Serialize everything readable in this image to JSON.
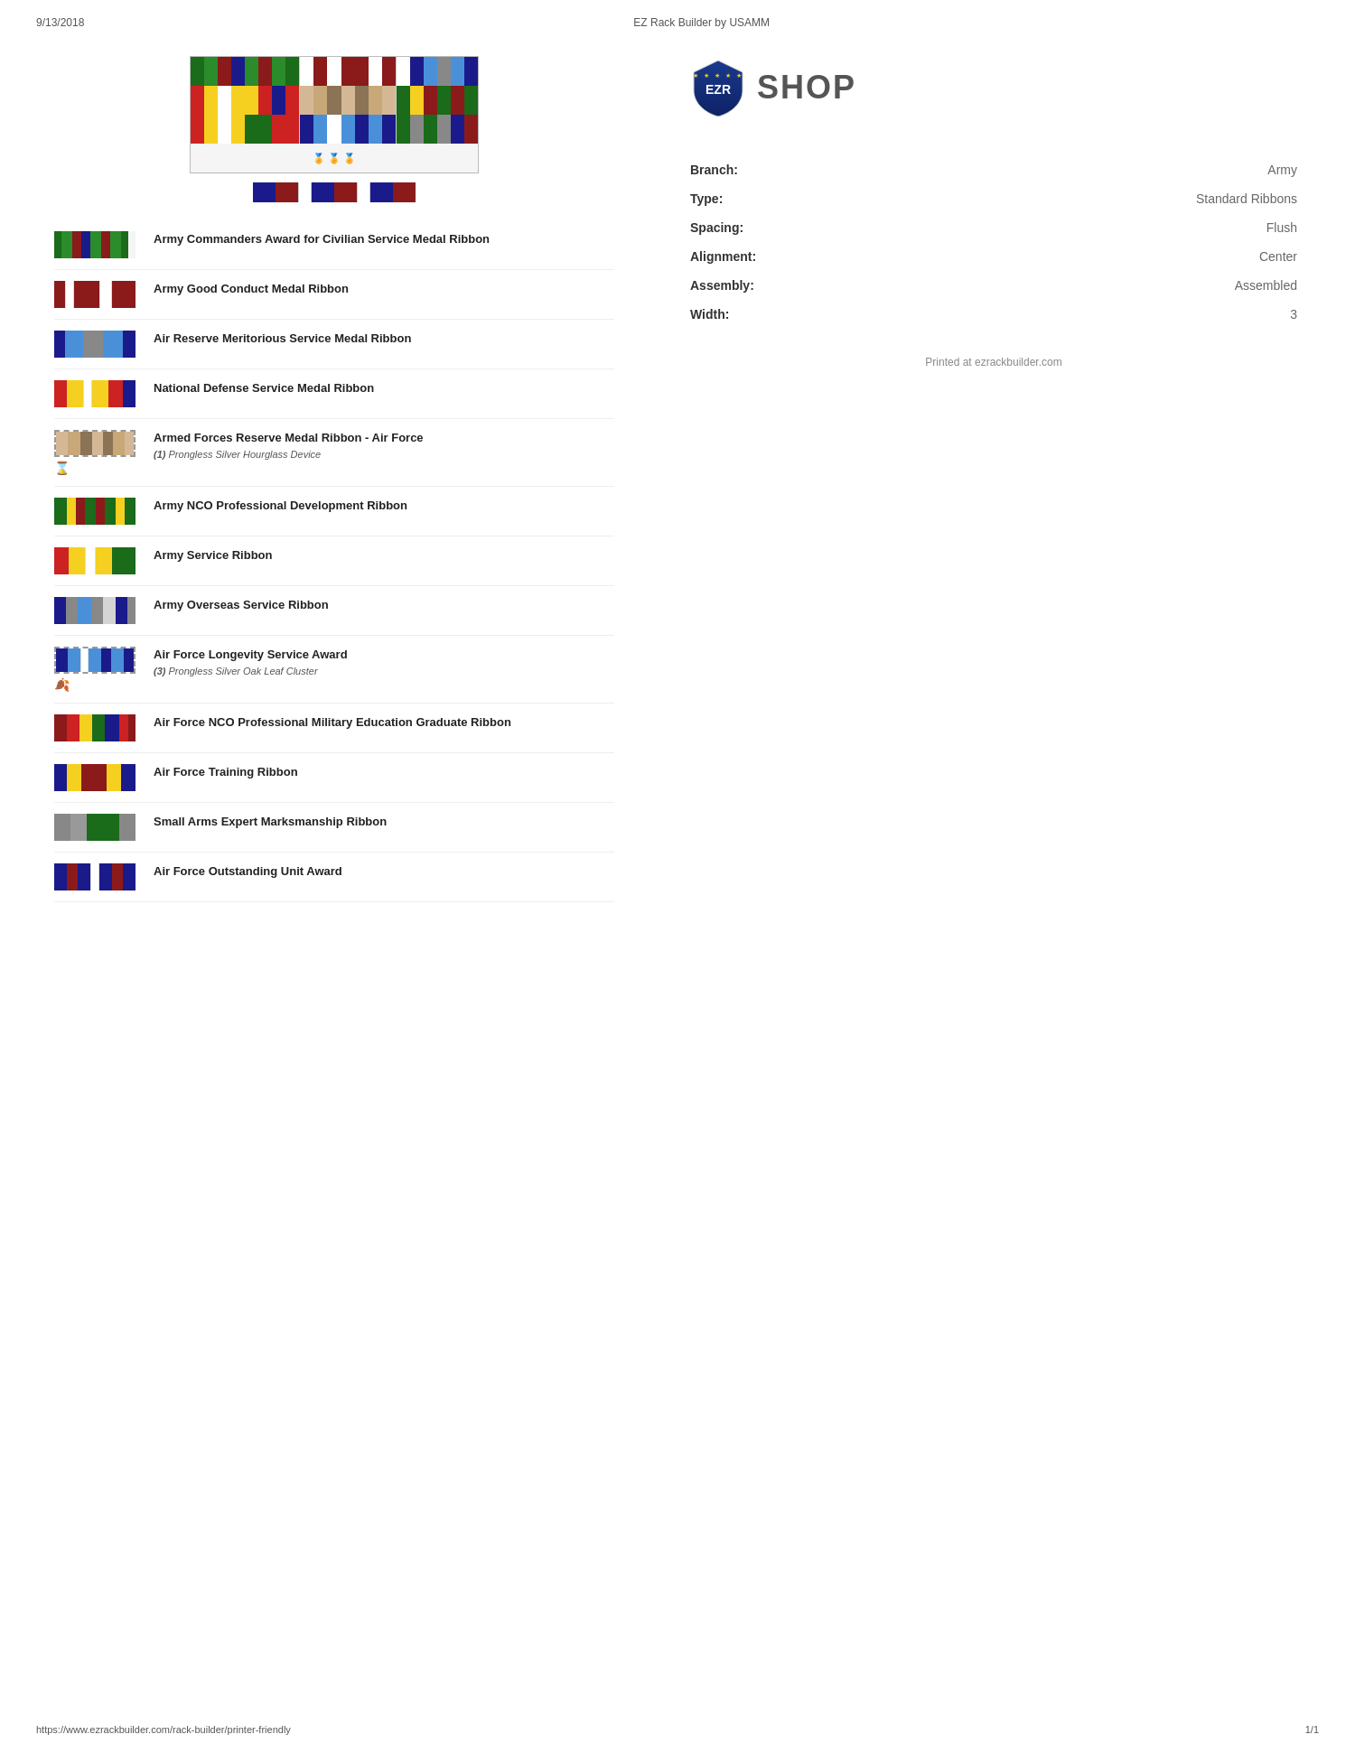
{
  "header": {
    "date": "9/13/2018",
    "title": "EZ Rack Builder by USAMM"
  },
  "info": {
    "branch_label": "Branch:",
    "branch_value": "Army",
    "type_label": "Type:",
    "type_value": "Standard Ribbons",
    "spacing_label": "Spacing:",
    "spacing_value": "Flush",
    "alignment_label": "Alignment:",
    "alignment_value": "Center",
    "assembly_label": "Assembly:",
    "assembly_value": "Assembled",
    "width_label": "Width:",
    "width_value": "3"
  },
  "printed_at": "Printed at ezrackbuilder.com",
  "footer": {
    "url": "https://www.ezrackbuilder.com/rack-builder/printer-friendly",
    "page": "1/1"
  },
  "ribbons": [
    {
      "name": "Army Commanders Award for Civilian Service Medal Ribbon",
      "style": "commanders",
      "dashed": false
    },
    {
      "name": "Army Good Conduct Medal Ribbon",
      "style": "goodconduct",
      "dashed": false
    },
    {
      "name": "Air Reserve Meritorious Service Medal Ribbon",
      "style": "airreserve",
      "dashed": false
    },
    {
      "name": "National Defense Service Medal Ribbon",
      "style": "nationaldefense",
      "dashed": false
    },
    {
      "name": "Armed Forces Reserve Medal Ribbon - Air Force",
      "style": "armedforces",
      "dashed": true,
      "device": "(1) Prongless Silver Hourglass Device",
      "device_num": "1",
      "device_text": "Prongless Silver Hourglass Device",
      "device_icon": "hourglass"
    },
    {
      "name": "Army NCO Professional Development Ribbon",
      "style": "nco",
      "dashed": false
    },
    {
      "name": "Army Service Ribbon",
      "style": "armyservice",
      "dashed": false
    },
    {
      "name": "Army Overseas Service Ribbon",
      "style": "armyoverseas",
      "dashed": false
    },
    {
      "name": "Air Force Longevity Service Award",
      "style": "aflongevity",
      "dashed": true,
      "device": "(3) Prongless Silver Oak Leaf Cluster",
      "device_num": "3",
      "device_text": "Prongless Silver Oak Leaf Cluster",
      "device_icon": "oakleaf"
    },
    {
      "name": "Air Force NCO Professional Military Education Graduate Ribbon",
      "style": "afnco",
      "dashed": false
    },
    {
      "name": "Air Force Training Ribbon",
      "style": "aftraining",
      "dashed": false
    },
    {
      "name": "Small Arms Expert Marksmanship Ribbon",
      "style": "smallarms",
      "dashed": false
    },
    {
      "name": "Air Force Outstanding Unit Award",
      "style": "afoutstanding",
      "dashed": false
    }
  ]
}
